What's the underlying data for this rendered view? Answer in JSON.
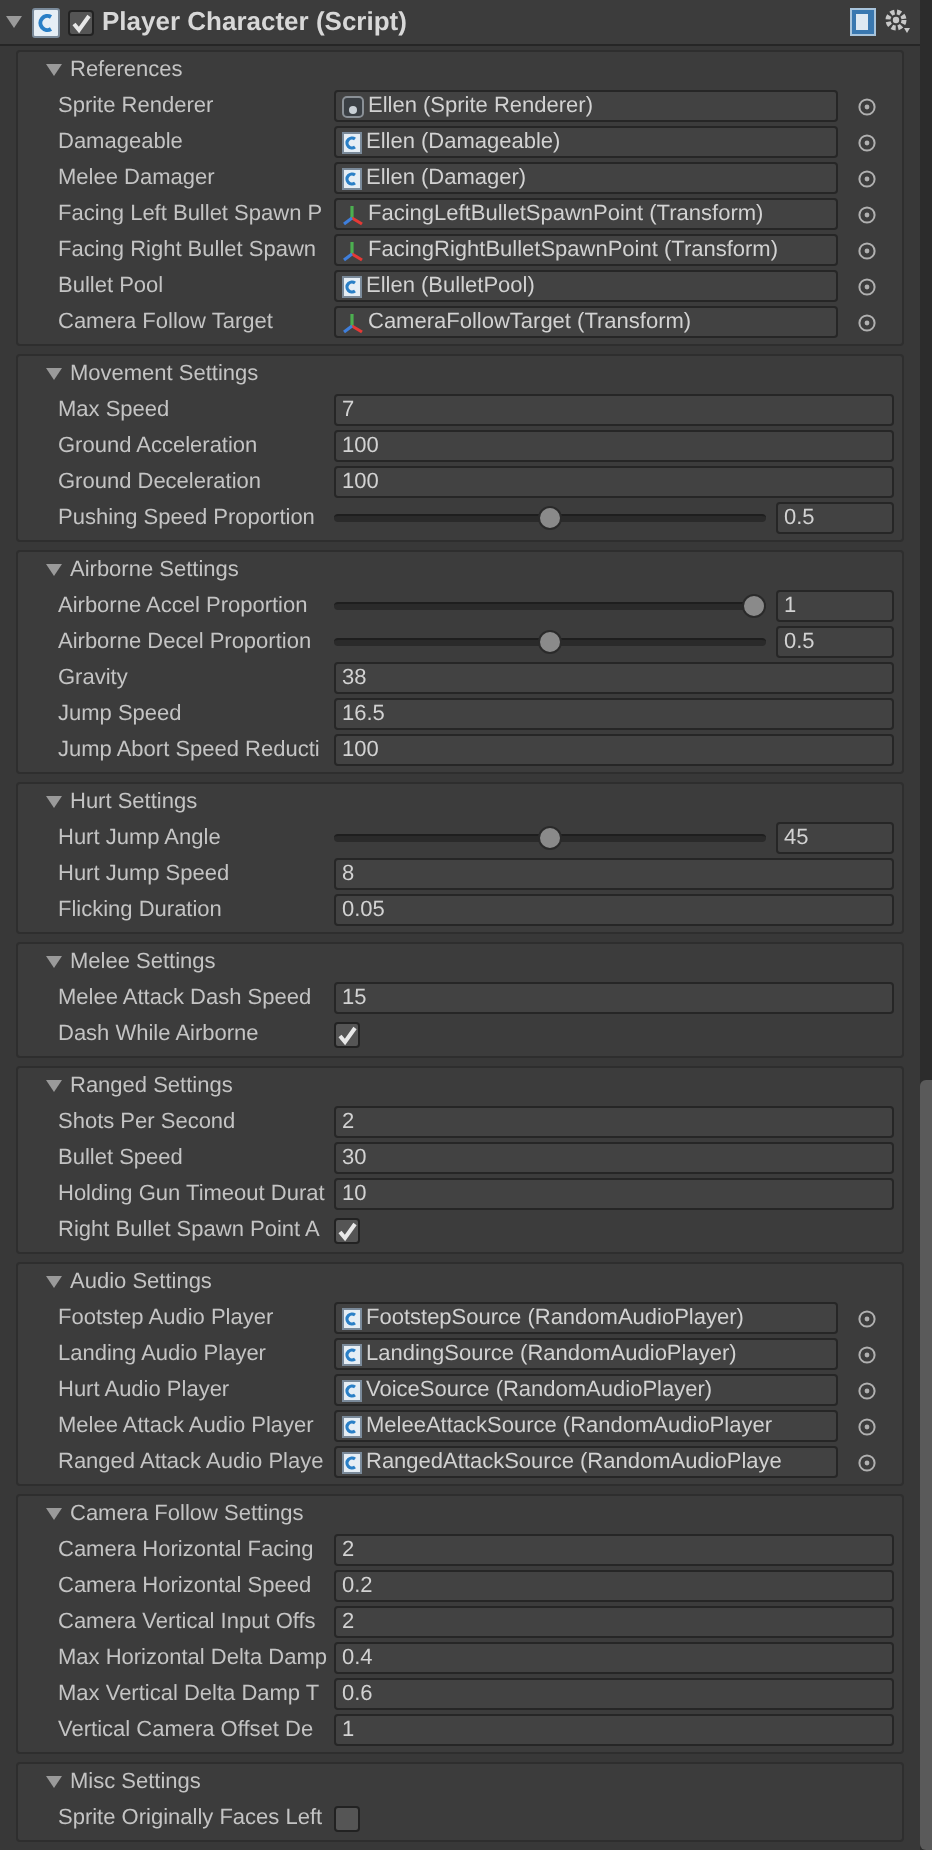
{
  "component": {
    "title": "Player Character (Script)",
    "enabled": true,
    "expanded": true
  },
  "sections": [
    {
      "title": "References",
      "expanded": true,
      "fields": [
        {
          "label": "Sprite Renderer",
          "kind": "sprite_object",
          "value": "Ellen (Sprite Renderer)"
        },
        {
          "label": "Damageable",
          "kind": "script_object",
          "value": "Ellen (Damageable)"
        },
        {
          "label": "Melee Damager",
          "kind": "script_object",
          "value": "Ellen (Damager)"
        },
        {
          "label": "Facing Left Bullet Spawn P",
          "kind": "transform_object",
          "value": "FacingLeftBulletSpawnPoint (Transform)"
        },
        {
          "label": "Facing Right Bullet Spawn",
          "kind": "transform_object",
          "value": "FacingRightBulletSpawnPoint (Transform)"
        },
        {
          "label": "Bullet Pool",
          "kind": "script_object",
          "value": "Ellen (BulletPool)"
        },
        {
          "label": "Camera Follow Target",
          "kind": "transform_object",
          "value": "CameraFollowTarget (Transform)"
        }
      ]
    },
    {
      "title": "Movement Settings",
      "expanded": true,
      "fields": [
        {
          "label": "Max Speed",
          "kind": "number",
          "value": "7"
        },
        {
          "label": "Ground Acceleration",
          "kind": "number",
          "value": "100"
        },
        {
          "label": "Ground Deceleration",
          "kind": "number",
          "value": "100"
        },
        {
          "label": "Pushing Speed Proportion",
          "kind": "slider",
          "level": 0.5,
          "value": "0.5"
        }
      ]
    },
    {
      "title": "Airborne Settings",
      "expanded": true,
      "fields": [
        {
          "label": "Airborne Accel Proportion",
          "kind": "slider",
          "level": 1,
          "value": "1"
        },
        {
          "label": "Airborne Decel Proportion",
          "kind": "slider",
          "level": 0.5,
          "value": "0.5"
        },
        {
          "label": "Gravity",
          "kind": "number",
          "value": "38"
        },
        {
          "label": "Jump Speed",
          "kind": "number",
          "value": "16.5"
        },
        {
          "label": "Jump Abort Speed Reducti",
          "kind": "number",
          "value": "100"
        }
      ]
    },
    {
      "title": "Hurt Settings",
      "expanded": true,
      "fields": [
        {
          "label": "Hurt Jump Angle",
          "kind": "slider",
          "level": 0.5,
          "value": "45"
        },
        {
          "label": "Hurt Jump Speed",
          "kind": "number",
          "value": "8"
        },
        {
          "label": "Flicking Duration",
          "kind": "number",
          "value": "0.05"
        }
      ]
    },
    {
      "title": "Melee Settings",
      "expanded": true,
      "fields": [
        {
          "label": "Melee Attack Dash Speed",
          "kind": "number",
          "value": "15"
        },
        {
          "label": "Dash While Airborne",
          "kind": "toggle",
          "checked": true
        }
      ]
    },
    {
      "title": "Ranged Settings",
      "expanded": true,
      "fields": [
        {
          "label": "Shots Per Second",
          "kind": "number",
          "value": "2"
        },
        {
          "label": "Bullet Speed",
          "kind": "number",
          "value": "30"
        },
        {
          "label": "Holding Gun Timeout Durat",
          "kind": "number",
          "value": "10"
        },
        {
          "label": "Right Bullet Spawn Point A",
          "kind": "toggle",
          "checked": true
        }
      ]
    },
    {
      "title": "Audio Settings",
      "expanded": true,
      "fields": [
        {
          "label": "Footstep Audio Player",
          "kind": "script_object",
          "value": "FootstepSource (RandomAudioPlayer)"
        },
        {
          "label": "Landing Audio Player",
          "kind": "script_object",
          "value": "LandingSource (RandomAudioPlayer)"
        },
        {
          "label": "Hurt Audio Player",
          "kind": "script_object",
          "value": "VoiceSource (RandomAudioPlayer)"
        },
        {
          "label": "Melee Attack Audio Player",
          "kind": "script_object",
          "value": "MeleeAttackSource (RandomAudioPlayer"
        },
        {
          "label": "Ranged Attack Audio Playe",
          "kind": "script_object",
          "value": "RangedAttackSource (RandomAudioPlaye"
        }
      ]
    },
    {
      "title": "Camera Follow Settings",
      "expanded": true,
      "fields": [
        {
          "label": "Camera Horizontal Facing",
          "kind": "number",
          "value": "2"
        },
        {
          "label": "Camera Horizontal Speed",
          "kind": "number",
          "value": "0.2"
        },
        {
          "label": "Camera Vertical Input Offs",
          "kind": "number",
          "value": "2"
        },
        {
          "label": "Max Horizontal Delta Damp",
          "kind": "number",
          "value": "0.4"
        },
        {
          "label": "Max Vertical Delta Damp T",
          "kind": "number",
          "value": "0.6"
        },
        {
          "label": "Vertical Camera Offset De",
          "kind": "number",
          "value": "1"
        }
      ]
    },
    {
      "title": "Misc Settings",
      "expanded": true,
      "fields": [
        {
          "label": "Sprite Originally Faces Left",
          "kind": "toggle",
          "checked": false
        }
      ]
    }
  ]
}
